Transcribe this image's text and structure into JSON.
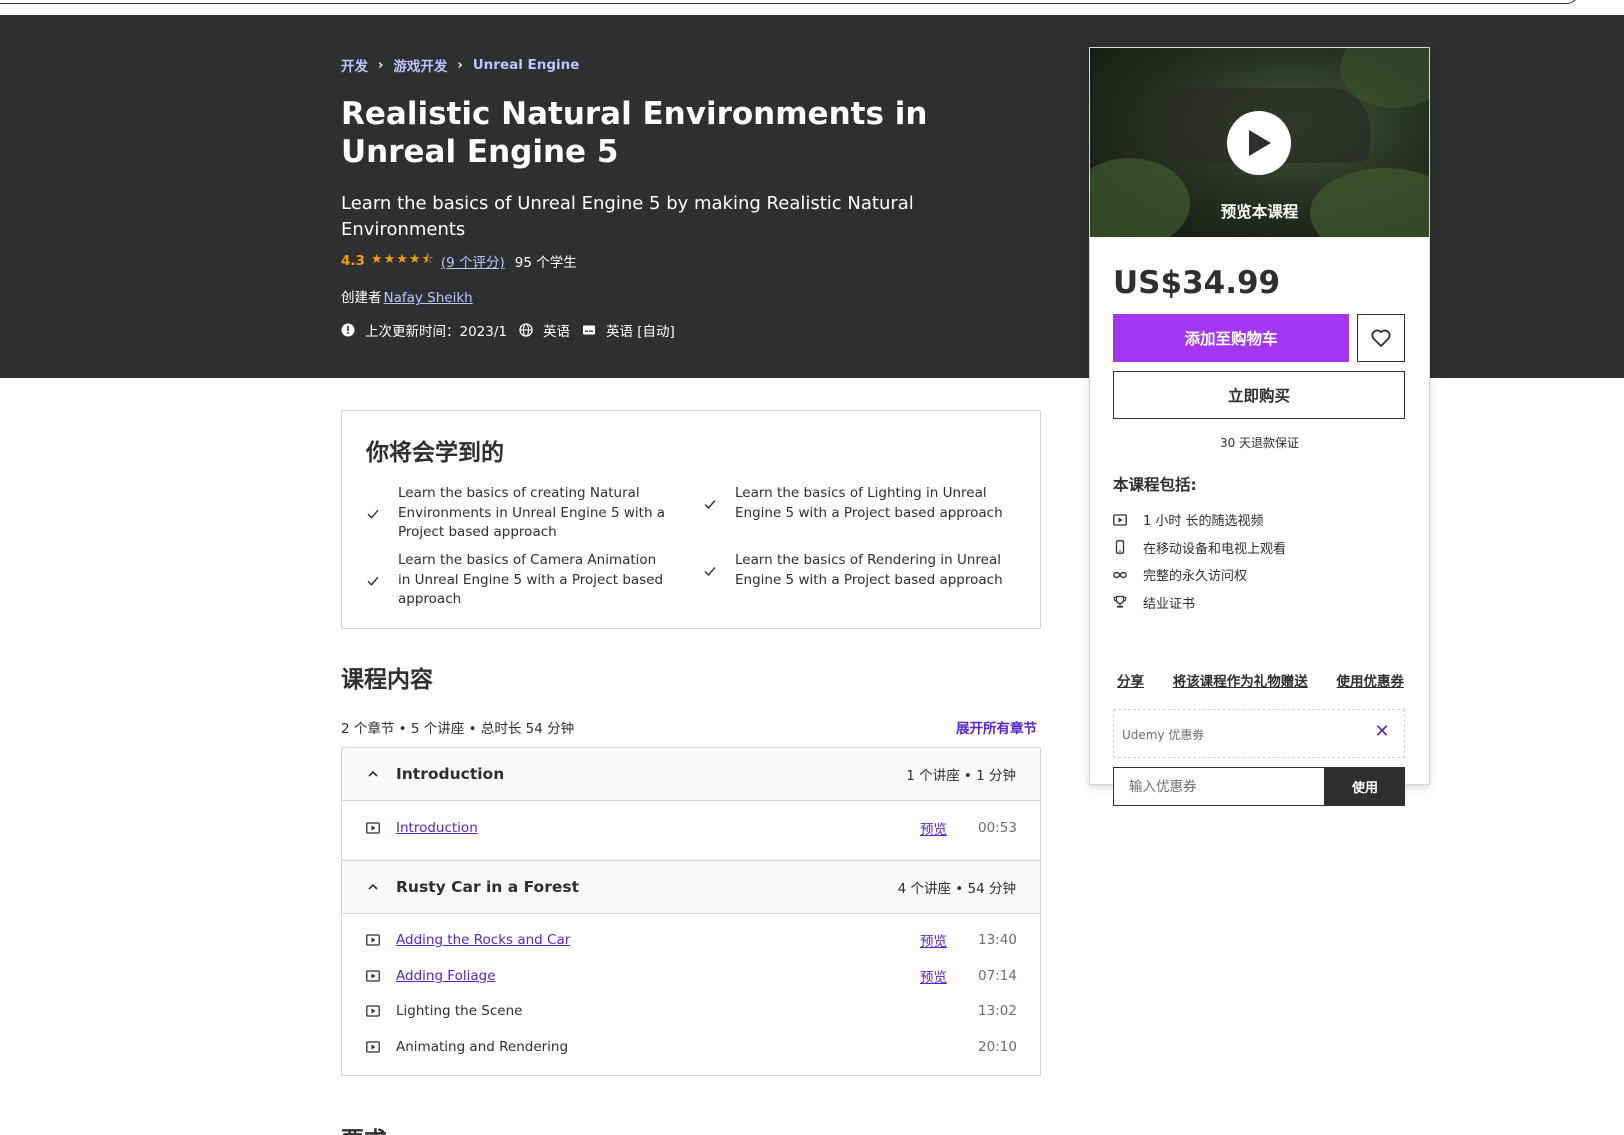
{
  "breadcrumb": [
    "开发",
    "游戏开发",
    "Unreal Engine"
  ],
  "course": {
    "title": "Realistic Natural Environments in Unreal Engine 5",
    "subtitle": "Learn the basics of Unreal Engine 5 by making Realistic Natural Environments",
    "rating": "4.3",
    "rating_count_link": "(9 个评分)",
    "students": "95 个学生",
    "creator_label": "创建者",
    "creator": "Nafay Sheikh",
    "updated": "上次更新时间：2023/1",
    "language": "英语",
    "captions": "英语 [自动]"
  },
  "sidebar": {
    "preview_label": "预览本课程",
    "price": "US$34.99",
    "add_to_cart": "添加至购物车",
    "buy_now": "立即购买",
    "guarantee": "30 天退款保证",
    "includes_title": "本课程包括:",
    "includes": [
      {
        "icon": "video-icon",
        "text": "1 小时 长的随选视频"
      },
      {
        "icon": "mobile-icon",
        "text": "在移动设备和电视上观看"
      },
      {
        "icon": "infinity-icon",
        "text": "完整的永久访问权"
      },
      {
        "icon": "trophy-icon",
        "text": "结业证书"
      }
    ],
    "share": "分享",
    "gift": "将该课程作为礼物赠送",
    "apply_coupon": "使用优惠券",
    "coupon_label": "Udemy 优惠券",
    "coupon_placeholder": "输入优惠券",
    "coupon_apply_button": "使用"
  },
  "learn": {
    "title": "你将会学到的",
    "items": [
      "Learn the basics of creating Natural Environments in Unreal Engine 5 with a Project based approach",
      "Learn the basics of Lighting in Unreal Engine 5 with a Project based approach",
      "Learn the basics of Camera Animation in Unreal Engine 5 with a Project based approach",
      "Learn the basics of Rendering in Unreal Engine 5 with a Project based approach"
    ]
  },
  "content": {
    "title": "课程内容",
    "summary": "2 个章节 • 5 个讲座 • 总时长 54 分钟",
    "expand_all": "展开所有章节",
    "sections": [
      {
        "title": "Introduction",
        "meta": "1 个讲座 • 1 分钟",
        "lectures": [
          {
            "title": "Introduction",
            "preview": "预览",
            "duration": "00:53"
          }
        ]
      },
      {
        "title": "Rusty Car in a Forest",
        "meta": "4 个讲座 • 54 分钟",
        "lectures": [
          {
            "title": "Adding the Rocks and Car",
            "preview": "预览",
            "duration": "13:40"
          },
          {
            "title": "Adding Foliage",
            "preview": "预览",
            "duration": "07:14"
          },
          {
            "title": "Lighting the Scene",
            "preview": "",
            "duration": "13:02"
          },
          {
            "title": "Animating and Rendering",
            "preview": "",
            "duration": "20:10"
          }
        ]
      }
    ]
  },
  "next_heading": "要求",
  "colors": {
    "hero_bg": "#2d2f31",
    "accent_purple": "#a435f0",
    "link_purple": "#5624d0",
    "star_orange": "#f69c08",
    "breadcrumb_link": "#c0c4fc"
  }
}
